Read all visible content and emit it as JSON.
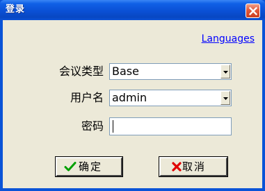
{
  "window": {
    "title": "登录"
  },
  "dialog": {
    "languages_link": "Languages",
    "conference_type": {
      "label": "会议类型",
      "value": "Base"
    },
    "username": {
      "label": "用户名",
      "value": "admin"
    },
    "password": {
      "label": "密码",
      "value": ""
    },
    "ok_button": {
      "label": "确定",
      "icon": "checkmark-icon"
    },
    "cancel_button": {
      "label": "取消",
      "icon": "x-mark-icon"
    }
  },
  "colors": {
    "titlebar": "#0a50d5",
    "client_bg": "#ece9d8",
    "link": "#0000ff",
    "close_button": "#e2593a",
    "checkmark": "#00a000",
    "x_mark": "#e00000"
  }
}
